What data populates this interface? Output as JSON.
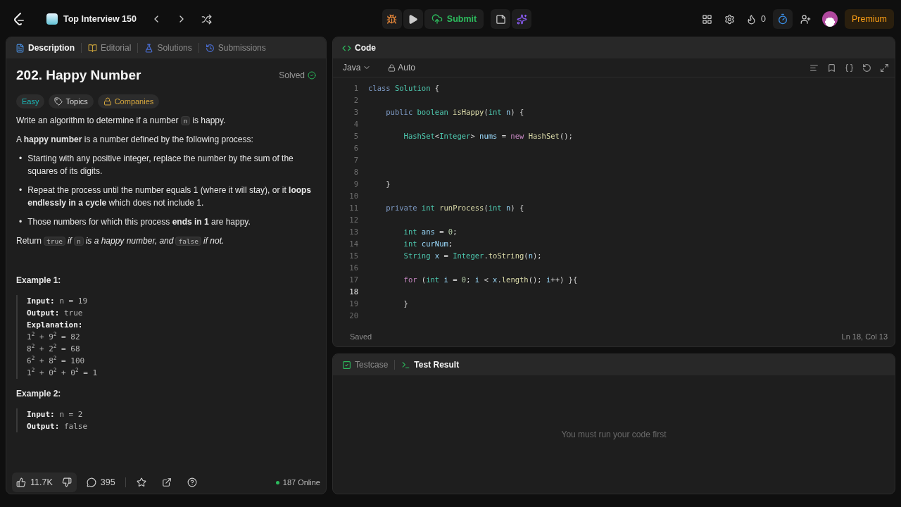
{
  "topbar": {
    "list_title": "Top Interview 150",
    "submit": "Submit",
    "streak": "0",
    "premium": "Premium"
  },
  "left_tabs": [
    {
      "label": "Description",
      "selected": true
    },
    {
      "label": "Editorial",
      "selected": false
    },
    {
      "label": "Solutions",
      "selected": false
    },
    {
      "label": "Submissions",
      "selected": false
    }
  ],
  "problem": {
    "title": "202. Happy Number",
    "status": "Solved",
    "difficulty": "Easy",
    "topics": "Topics",
    "companies": "Companies",
    "paragraphs": [
      {
        "kind": "para",
        "segments": [
          {
            "kind": "text",
            "text": "Write an algorithm to determine if a number"
          },
          {
            "kind": "code",
            "text": "n"
          },
          {
            "kind": "text",
            "text": "is happy."
          }
        ]
      },
      {
        "kind": "para",
        "segments": [
          {
            "kind": "text",
            "text": "A **happy number** is a number defined by the following process:"
          }
        ]
      },
      {
        "kind": "bullet",
        "marker": "•",
        "segments": [
          {
            "kind": "text",
            "text": "Starting with any positive integer, replace the number by the sum of the squares of its digits."
          }
        ]
      },
      {
        "kind": "bullet",
        "marker": "•",
        "segments": [
          {
            "kind": "text",
            "text": "Repeat the process until the number equals 1 (where it will stay), or it **loops endlessly in a cycle** which does not include 1."
          }
        ]
      },
      {
        "kind": "bullet",
        "marker": "•",
        "segments": [
          {
            "kind": "text",
            "text": "Those numbers for which this process **ends in 1** are happy."
          }
        ]
      },
      {
        "kind": "para",
        "segments": [
          {
            "kind": "text",
            "text": "Return"
          },
          {
            "kind": "code",
            "text": "true"
          },
          {
            "kind": "text",
            "text": "*if*"
          },
          {
            "kind": "code",
            "text": "n"
          },
          {
            "kind": "text",
            "text": "*is a happy number, and*"
          },
          {
            "kind": "code",
            "text": "false"
          },
          {
            "kind": "text",
            "text": "*if not.*"
          }
        ]
      }
    ],
    "examples": [
      {
        "title": "Example 1:",
        "lines": [
          {
            "label": "Input:",
            "value": "n = 19"
          },
          {
            "label": "Output:",
            "value": "true"
          },
          {
            "label": "Explanation:"
          },
          {
            "value": "1$^{2}$ + 9$^{2}$ = 82"
          },
          {
            "value": "8$^{2}$ + 2$^{2}$ = 68"
          },
          {
            "value": "6$^{2}$ + 8$^{2}$ = 100"
          },
          {
            "value": "1$^{2}$ + 0$^{2}$ + 0$^{2}$ = 1"
          }
        ]
      },
      {
        "title": "Example 2:",
        "lines": [
          {
            "label": "Input:",
            "value": "n = 2"
          },
          {
            "label": "Output:",
            "value": "false"
          }
        ]
      }
    ]
  },
  "left_footer": {
    "likes": "11.7K",
    "comments": "395",
    "online": "187 Online"
  },
  "code_panel": {
    "title": "Code",
    "language": "Java",
    "mode": "Auto",
    "status": "Saved",
    "cursor": "Ln 18, Col 13",
    "lines": [
      {
        "number": "1",
        "current": false,
        "tokens": [
          {
            "kind": "kw",
            "text": "class"
          },
          {
            "kind": "type",
            "text": " Solution"
          },
          {
            "kind": "plain",
            "text": " {"
          }
        ]
      },
      {
        "number": "2",
        "current": false
      },
      {
        "number": "3",
        "current": false,
        "tokens": [
          {
            "kind": "kw",
            "text": "    public"
          },
          {
            "kind": "type",
            "text": " boolean"
          },
          {
            "kind": "fn",
            "text": " isHappy"
          },
          {
            "kind": "plain",
            "text": "("
          },
          {
            "kind": "type",
            "text": "int"
          },
          {
            "kind": "var",
            "text": " n"
          },
          {
            "kind": "plain",
            "text": ") {"
          }
        ]
      },
      {
        "number": "4",
        "current": false
      },
      {
        "number": "5",
        "current": false,
        "tokens": [
          {
            "kind": "type",
            "text": "        HashSet"
          },
          {
            "kind": "plain",
            "text": "<"
          },
          {
            "kind": "type",
            "text": "Integer"
          },
          {
            "kind": "plain",
            "text": ">"
          },
          {
            "kind": "var",
            "text": " nums"
          },
          {
            "kind": "plain",
            "text": " ="
          },
          {
            "kind": "ctrl",
            "text": " new"
          },
          {
            "kind": "fn",
            "text": " HashSet"
          },
          {
            "kind": "plain",
            "text": "();"
          }
        ]
      },
      {
        "number": "6",
        "current": false
      },
      {
        "number": "7",
        "current": false
      },
      {
        "number": "8",
        "current": false
      },
      {
        "number": "9",
        "current": false,
        "tokens": [
          {
            "kind": "plain",
            "text": "    }"
          }
        ]
      },
      {
        "number": "10",
        "current": false
      },
      {
        "number": "11",
        "current": false,
        "tokens": [
          {
            "kind": "kw",
            "text": "    private"
          },
          {
            "kind": "type",
            "text": " int"
          },
          {
            "kind": "fn",
            "text": " runProcess"
          },
          {
            "kind": "plain",
            "text": "("
          },
          {
            "kind": "type",
            "text": "int"
          },
          {
            "kind": "var",
            "text": " n"
          },
          {
            "kind": "plain",
            "text": ") {"
          }
        ]
      },
      {
        "number": "12",
        "current": false
      },
      {
        "number": "13",
        "current": false,
        "tokens": [
          {
            "kind": "type",
            "text": "        int"
          },
          {
            "kind": "var",
            "text": " ans"
          },
          {
            "kind": "plain",
            "text": " ="
          },
          {
            "kind": "num",
            "text": " 0"
          },
          {
            "kind": "plain",
            "text": ";"
          }
        ]
      },
      {
        "number": "14",
        "current": false,
        "tokens": [
          {
            "kind": "type",
            "text": "        int"
          },
          {
            "kind": "var",
            "text": " curNum"
          },
          {
            "kind": "plain",
            "text": ";"
          }
        ]
      },
      {
        "number": "15",
        "current": false,
        "tokens": [
          {
            "kind": "type",
            "text": "        String"
          },
          {
            "kind": "var",
            "text": " x"
          },
          {
            "kind": "plain",
            "text": " ="
          },
          {
            "kind": "type",
            "text": " Integer"
          },
          {
            "kind": "plain",
            "text": "."
          },
          {
            "kind": "fn",
            "text": "toString"
          },
          {
            "kind": "plain",
            "text": "("
          },
          {
            "kind": "var",
            "text": "n"
          },
          {
            "kind": "plain",
            "text": ");"
          }
        ]
      },
      {
        "number": "16",
        "current": false
      },
      {
        "number": "17",
        "current": false,
        "tokens": [
          {
            "kind": "ctrl",
            "text": "        for"
          },
          {
            "kind": "plain",
            "text": " ("
          },
          {
            "kind": "type",
            "text": "int"
          },
          {
            "kind": "var",
            "text": " i"
          },
          {
            "kind": "plain",
            "text": " ="
          },
          {
            "kind": "num",
            "text": " 0"
          },
          {
            "kind": "plain",
            "text": ";"
          },
          {
            "kind": "var",
            "text": " i"
          },
          {
            "kind": "plain",
            "text": " <"
          },
          {
            "kind": "var",
            "text": " x"
          },
          {
            "kind": "plain",
            "text": "."
          },
          {
            "kind": "fn",
            "text": "length"
          },
          {
            "kind": "plain",
            "text": "();"
          },
          {
            "kind": "var",
            "text": " i"
          },
          {
            "kind": "plain",
            "text": "++) }{"
          }
        ]
      },
      {
        "number": "18",
        "current": true
      },
      {
        "number": "19",
        "current": false,
        "tokens": [
          {
            "kind": "plain",
            "text": "        }"
          }
        ]
      },
      {
        "number": "20",
        "current": false
      }
    ]
  },
  "test_tabs": [
    {
      "label": "Testcase",
      "selected": false
    },
    {
      "label": "Test Result",
      "selected": true
    }
  ],
  "test_message": "You must run your code first"
}
